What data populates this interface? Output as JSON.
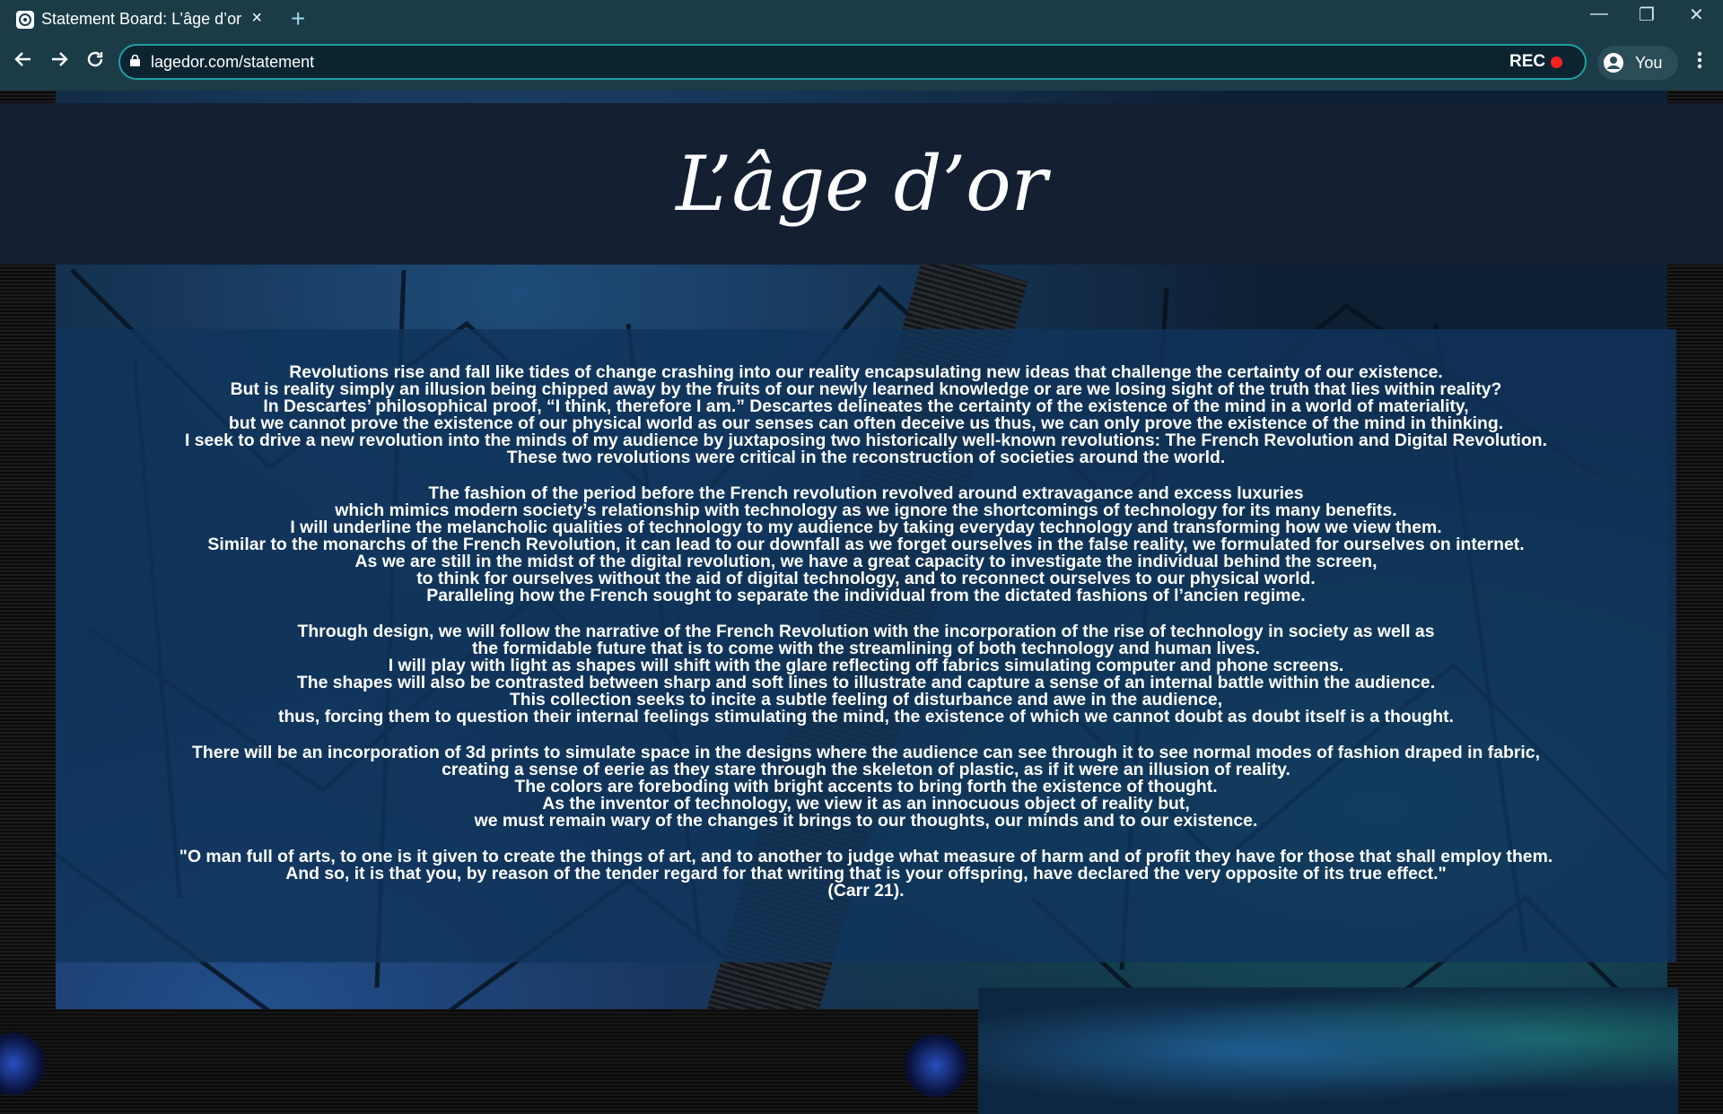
{
  "browser": {
    "tab_title": "Statement Board: L’âge d’or",
    "new_tab_symbol": "+",
    "tab_close_symbol": "×",
    "url": "lagedor.com/statement",
    "rec_label": "REC",
    "profile_label": "You",
    "window_controls": [
      "—",
      "❐",
      "✕"
    ]
  },
  "icons": {
    "back": "arrow-left-icon",
    "forward": "arrow-right-icon",
    "reload": "reload-icon",
    "lock": "lock-icon",
    "profile": "account-circle-icon",
    "menu": "vertical-dots-icon"
  },
  "site": {
    "logo_text": "L’âge d’or"
  },
  "statement": {
    "paragraphs": [
      [
        "Revolutions rise and fall like tides of change crashing into our reality encapsulating new ideas that challenge the certainty of our existence.",
        "But is reality simply an illusion being chipped away by the fruits of our newly learned knowledge or are we losing sight of the truth that lies within reality?",
        "In Descartes’ philosophical proof, “I think, therefore I am.” Descartes delineates the certainty of the existence of the mind in a world of materiality,",
        "but we cannot prove the existence of our physical world as our senses can often deceive us thus, we can only prove the existence of the mind in thinking.",
        "I seek to drive a new revolution into the minds of my audience by juxtaposing two historically well-known revolutions: The French Revolution and Digital Revolution.",
        "These two revolutions were critical in the reconstruction of societies around the world."
      ],
      [
        "The fashion of the period before the French revolution revolved around extravagance and excess luxuries",
        "which mimics modern society’s relationship with technology as we ignore the shortcomings of technology for its many benefits.",
        "I will underline the melancholic qualities of technology to my audience by taking everyday technology and transforming how we view them.",
        "Similar to the monarchs of the French Revolution, it can lead to our downfall as we forget ourselves in the false reality, we formulated for ourselves on internet.",
        "As we are still in the midst of the digital revolution, we have a great capacity to investigate the individual behind the screen,",
        "to think for ourselves without the aid of digital technology, and to reconnect ourselves to our physical world.",
        "Paralleling how the French sought to separate the individual from the dictated fashions of l’ancien regime."
      ],
      [
        "Through design, we will follow the narrative of the French Revolution with the incorporation of the rise of technology in society as well as",
        "the formidable future that is to come with the streamlining of both technology and human lives.",
        "I will play with light as shapes will shift with the glare reflecting off fabrics simulating computer and phone screens.",
        "The shapes will also be contrasted between sharp and soft lines to illustrate and capture a sense of an internal battle within the audience.",
        "This collection seeks to incite a subtle feeling of disturbance and awe in the audience,",
        "thus, forcing them to question their internal feelings stimulating the mind, the existence of which we cannot doubt as doubt itself is a thought."
      ],
      [
        "There will be an incorporation of 3d prints to simulate space in the designs where the audience can see through it to see normal modes of fashion draped in fabric,",
        "creating a sense of eerie as they stare through the skeleton of plastic, as if it were an illusion of reality.",
        "The colors are foreboding with bright accents to bring forth the existence of thought.",
        "As the inventor of technology, we view it as an innocuous object of reality but,",
        "we must remain wary of the changes it brings to our thoughts, our minds and to our existence."
      ],
      [
        "\"O man full of arts, to one is it given to create the things of art, and to another to judge what measure of harm and of profit they have for those that shall employ them.",
        "And so, it is that you, by reason of the tender regard for that writing that is your offspring, have declared the very opposite of its true effect.\"",
        "(Carr 21)."
      ]
    ]
  },
  "colors": {
    "chrome": "#1b3c47",
    "omnibox_border": "#1fa0a4",
    "header_band": "#141f32",
    "panel": "#10345c",
    "rec_dot": "#ff2020"
  }
}
